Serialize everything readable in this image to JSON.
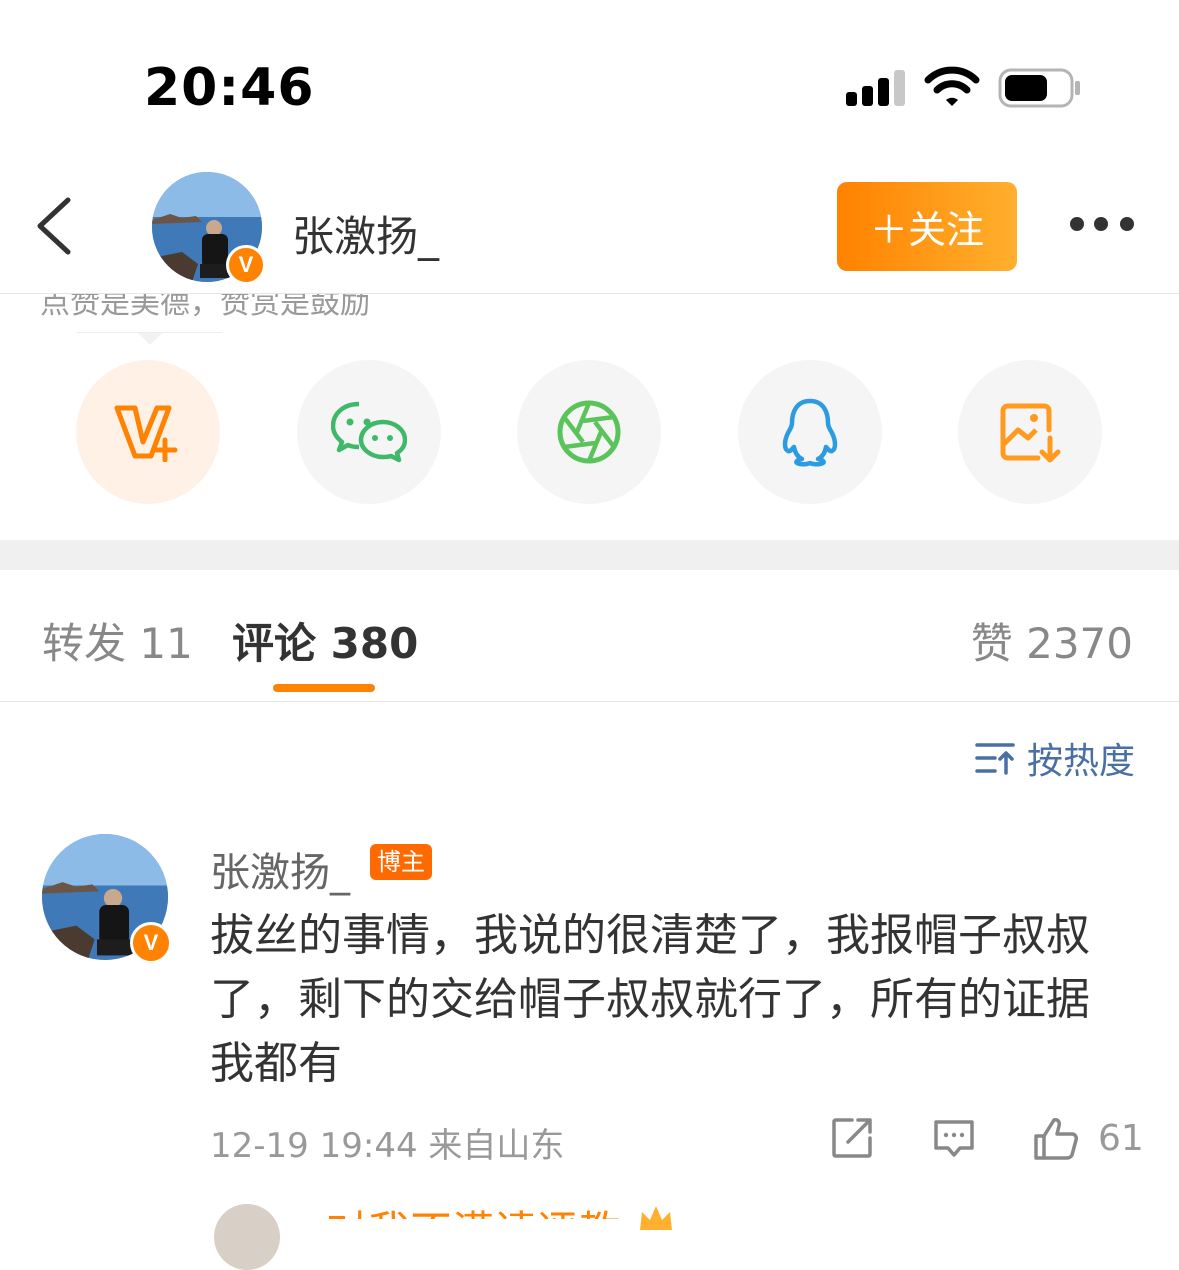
{
  "status_bar": {
    "time": "20:46"
  },
  "header": {
    "username": "张激扬_",
    "follow_label": "＋关注"
  },
  "share": {
    "clipped_hint": "点赞是美德，赞赏是鼓励",
    "icons": [
      "weibo-vplus-icon",
      "wechat-icon",
      "moments-icon",
      "qq-icon",
      "save-image-icon"
    ]
  },
  "tabs": {
    "repost": "转发 11",
    "comments": "评论 380",
    "likes": "赞 2370"
  },
  "sort_label": "按热度",
  "comment": {
    "author": "张激扬_",
    "tag": "博主",
    "text": "拔丝的事情，我说的很清楚了，我报帽子叔叔了，剩下的交给帽子叔叔就行了，所有的证据我都有",
    "meta": "12-19 19:44 来自山东",
    "like_count": "61"
  },
  "next_comment": {
    "author_partial": "对我不满请评教"
  },
  "colors": {
    "accent": "#ff8200",
    "link": "#4a6fa5"
  }
}
